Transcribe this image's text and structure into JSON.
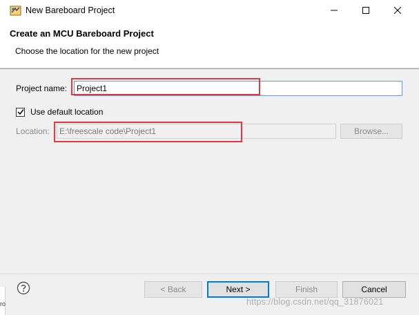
{
  "window": {
    "title": "New Bareboard Project",
    "icons": {
      "app": "eclipse-icon",
      "minimize": "minimize-icon",
      "maximize": "maximize-icon",
      "close": "close-icon"
    }
  },
  "banner": {
    "title": "Create an MCU Bareboard Project",
    "description": "Choose the location for the new project"
  },
  "form": {
    "project_name_label": "Project name:",
    "project_name_value": "Project1",
    "use_default_location_label": "Use default location",
    "use_default_location_checked": true,
    "location_label": "Location:",
    "location_value": "E:\\freescale code\\Project1",
    "browse_label": "Browse..."
  },
  "footer": {
    "help_icon": "help-icon",
    "back_label": "< Back",
    "next_label": "Next >",
    "finish_label": "Finish",
    "cancel_label": "Cancel"
  },
  "background": {
    "left_strip_text": "ro",
    "watermark": "https://blog.csdn.net/qq_31876021"
  },
  "colors": {
    "highlight_box": "#e0383e",
    "focus_border": "#569de5",
    "default_button_border": "#0078d7"
  }
}
